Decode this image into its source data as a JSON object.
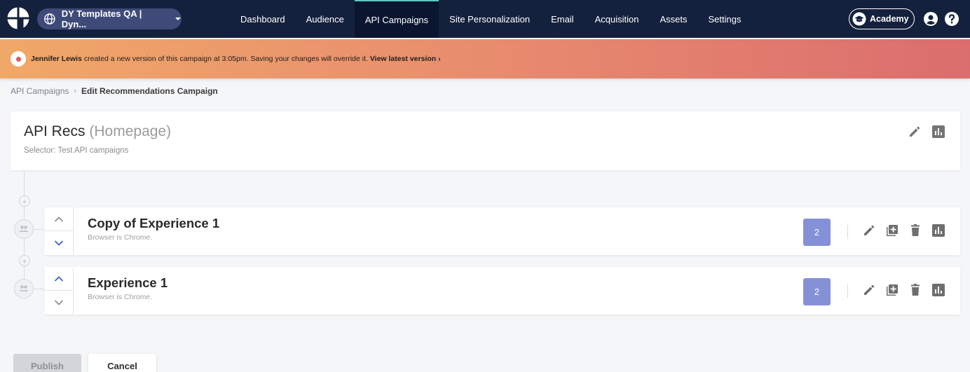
{
  "nav": {
    "site_selector": "DY Templates QA | Dyn...",
    "links": [
      "Dashboard",
      "Audience",
      "API Campaigns",
      "Site Personalization",
      "Email",
      "Acquisition",
      "Assets",
      "Settings"
    ],
    "active": "API Campaigns",
    "academy_label": "Academy",
    "accent_color": "#5ec6c0",
    "bg_color": "#14213d"
  },
  "banner": {
    "user": "Jennifer Lewis",
    "message": " created a new version of this campaign at 3:05pm. Saving your changes will override it. ",
    "link": "View latest version",
    "link_arrow": "›"
  },
  "breadcrumb": {
    "parent": "API Campaigns",
    "separator": "›",
    "current": "Edit Recommendations Campaign"
  },
  "campaign": {
    "name": "API Recs",
    "placement": "(Homepage)",
    "selector": "Selector: Test API campaigns"
  },
  "experiences": [
    {
      "title": "Copy of Experience 1",
      "condition": "Browser is Chrome.",
      "count": "2"
    },
    {
      "title": "Experience 1",
      "condition": "Browser is Chrome.",
      "count": "2"
    }
  ],
  "icons": {
    "timeline_plus": "+",
    "badge_color": "#8591d6"
  },
  "footer": {
    "publish_label": "Publish",
    "cancel_label": "Cancel"
  }
}
